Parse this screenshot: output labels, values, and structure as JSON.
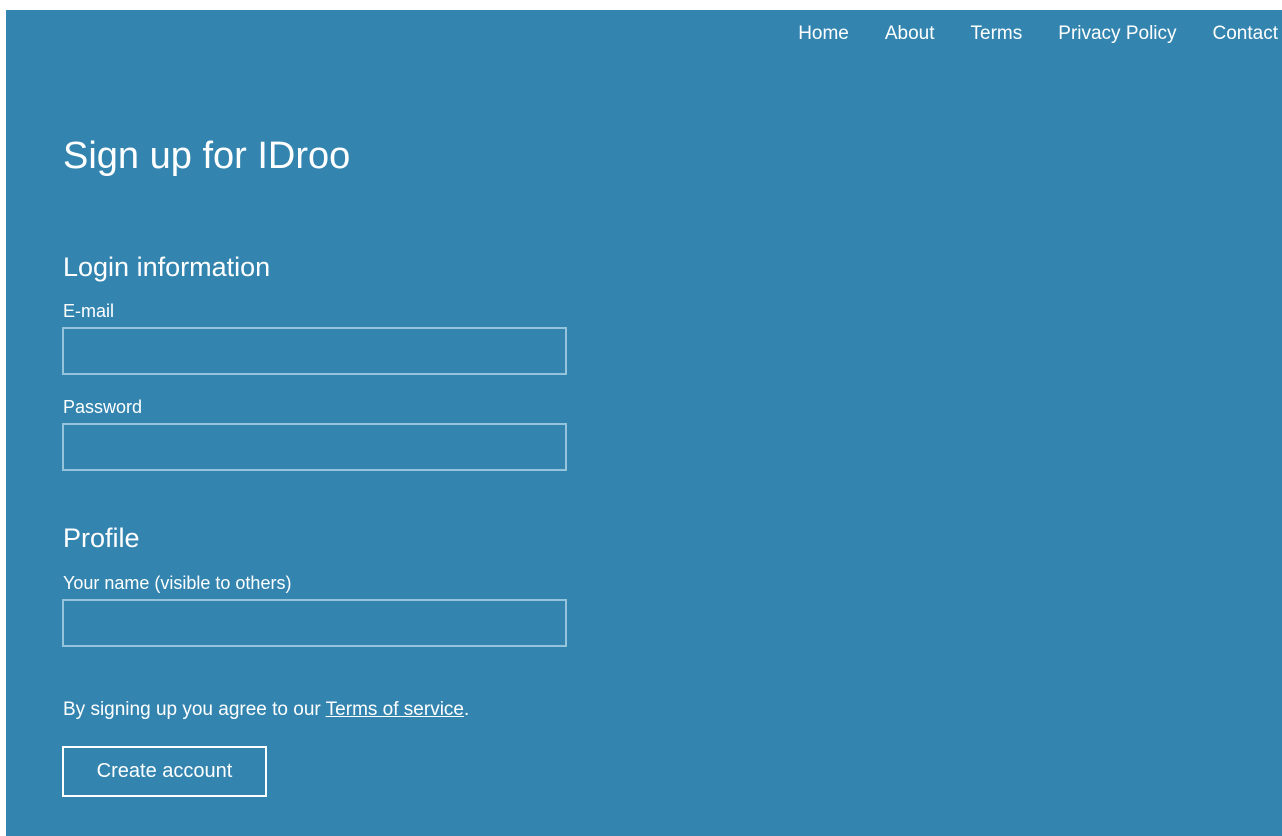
{
  "nav": {
    "items": [
      "Home",
      "About",
      "Terms",
      "Privacy Policy",
      "Contact"
    ]
  },
  "page": {
    "title": "Sign up for IDroo"
  },
  "login_section": {
    "heading": "Login information",
    "email_label": "E-mail",
    "email_value": "",
    "password_label": "Password",
    "password_value": ""
  },
  "profile_section": {
    "heading": "Profile",
    "name_label": "Your name (visible to others)",
    "name_value": ""
  },
  "agreement": {
    "prefix": "By signing up you agree to our ",
    "link_text": "Terms of service",
    "suffix": "."
  },
  "actions": {
    "create_account_label": "Create account"
  },
  "colors": {
    "background": "#3385b0",
    "text": "#ffffff",
    "input_border": "#95c3dc"
  }
}
